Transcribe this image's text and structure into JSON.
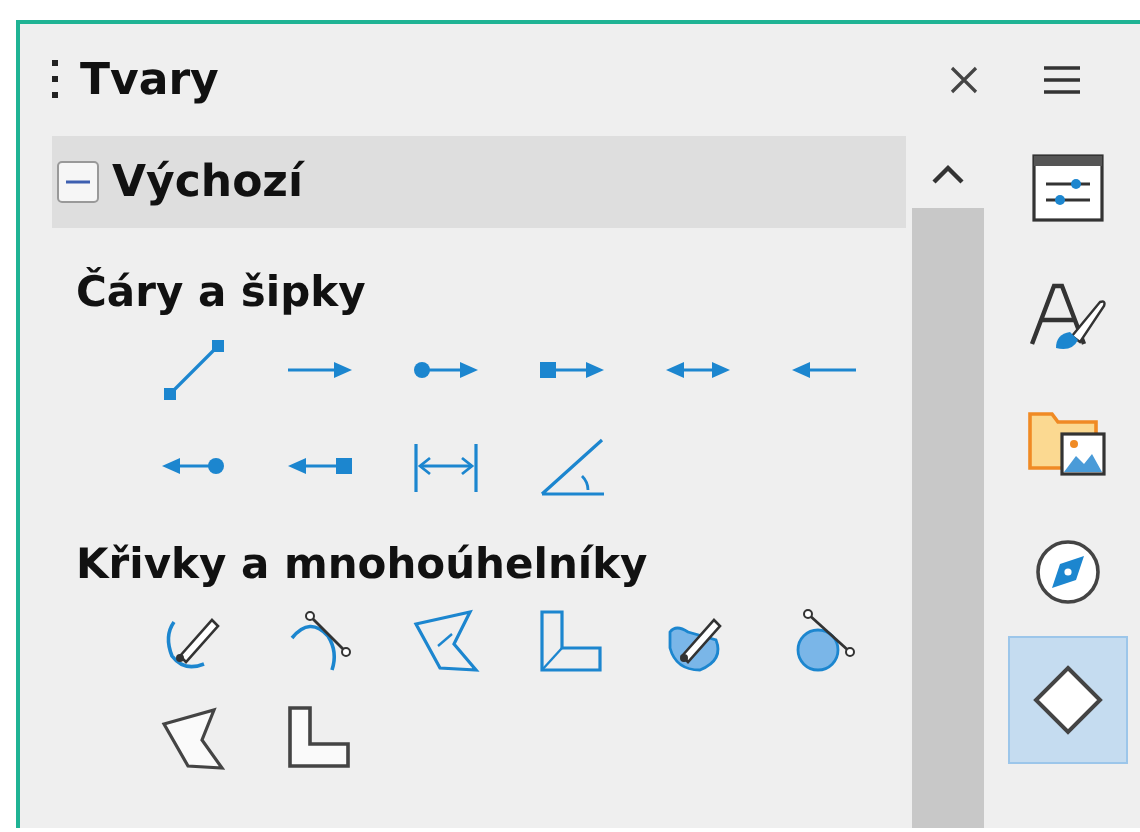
{
  "panel": {
    "title": "Tvary"
  },
  "section": {
    "title": "Výchozí",
    "expanded": true
  },
  "categories": [
    {
      "title": "Čáry a šipky",
      "shapes": [
        {
          "kind": "line"
        },
        {
          "kind": "arrow-right"
        },
        {
          "kind": "circle-arrow"
        },
        {
          "kind": "square-arrow"
        },
        {
          "kind": "double-arrow"
        },
        {
          "kind": "arrow-left"
        },
        {
          "kind": "arrow-circle"
        },
        {
          "kind": "arrow-square"
        },
        {
          "kind": "dimension"
        },
        {
          "kind": "angle"
        }
      ]
    },
    {
      "title": "Křivky a mnohoúhelníky",
      "shapes": [
        {
          "kind": "curve-edit"
        },
        {
          "kind": "arc-edit"
        },
        {
          "kind": "polygon-edit"
        },
        {
          "kind": "lshape-edit"
        },
        {
          "kind": "curve-filled-edit"
        },
        {
          "kind": "circle-edit"
        },
        {
          "kind": "polygon-filled"
        },
        {
          "kind": "lshape-filled"
        }
      ]
    }
  ],
  "sidebar_tabs": [
    {
      "kind": "properties",
      "selected": false
    },
    {
      "kind": "styles",
      "selected": false
    },
    {
      "kind": "gallery",
      "selected": false
    },
    {
      "kind": "navigator",
      "selected": false
    },
    {
      "kind": "shapes",
      "selected": true
    }
  ]
}
